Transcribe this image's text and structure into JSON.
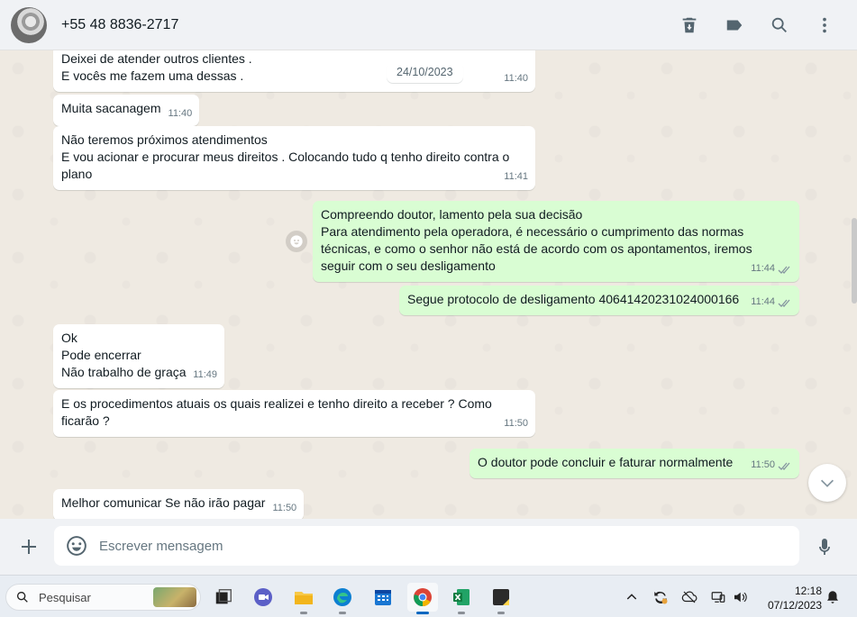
{
  "header": {
    "contact": "+55 48 8836-2717"
  },
  "chat": {
    "date_chip": "24/10/2023",
    "messages": [
      {
        "dir": "in",
        "text": "Deixei de atender outros clientes .\nE vocês me fazem uma dessas .",
        "time": "11:40"
      },
      {
        "dir": "in",
        "text": "Muita sacanagem",
        "time": "11:40"
      },
      {
        "dir": "in",
        "text": "Não teremos próximos atendimentos\nE vou acionar e procurar meus direitos . Colocando tudo q tenho direito contra o\nplano",
        "time": "11:41"
      },
      {
        "dir": "out",
        "text": "Compreendo doutor, lamento pela sua decisão\nPara atendimento pela operadora, é necessário o cumprimento das normas\ntécnicas, e como o senhor não está de acordo com os apontamentos, iremos\nseguir com o seu desligamento",
        "time": "11:44"
      },
      {
        "dir": "out",
        "text": "Segue protocolo de desligamento 40641420231024000166",
        "time": "11:44"
      },
      {
        "dir": "in",
        "text": "Ok\nPode encerrar\nNão trabalho de graça",
        "time": "11:49"
      },
      {
        "dir": "in",
        "text": "E os procedimentos atuais os quais realizei e tenho direito a receber ? Como\nficarão ?",
        "time": "11:50"
      },
      {
        "dir": "out",
        "text": "O doutor pode concluir e faturar normalmente",
        "time": "11:50"
      },
      {
        "dir": "in",
        "text": "Melhor comunicar Se não irão pagar",
        "time": "11:50"
      }
    ]
  },
  "composer": {
    "placeholder": "Escrever mensagem"
  },
  "taskbar": {
    "search_label": "Pesquisar",
    "time": "12:18",
    "date": "07/12/2023",
    "apps": [
      "task-view",
      "meet",
      "file-explorer",
      "edge",
      "calendar",
      "chrome",
      "excel",
      "sticky-notes"
    ]
  },
  "colors": {
    "outgoing_bubble": "#d9fdd3",
    "incoming_bubble": "#ffffff",
    "chat_bg": "#efeae2",
    "tick_read": "#8696a0"
  }
}
